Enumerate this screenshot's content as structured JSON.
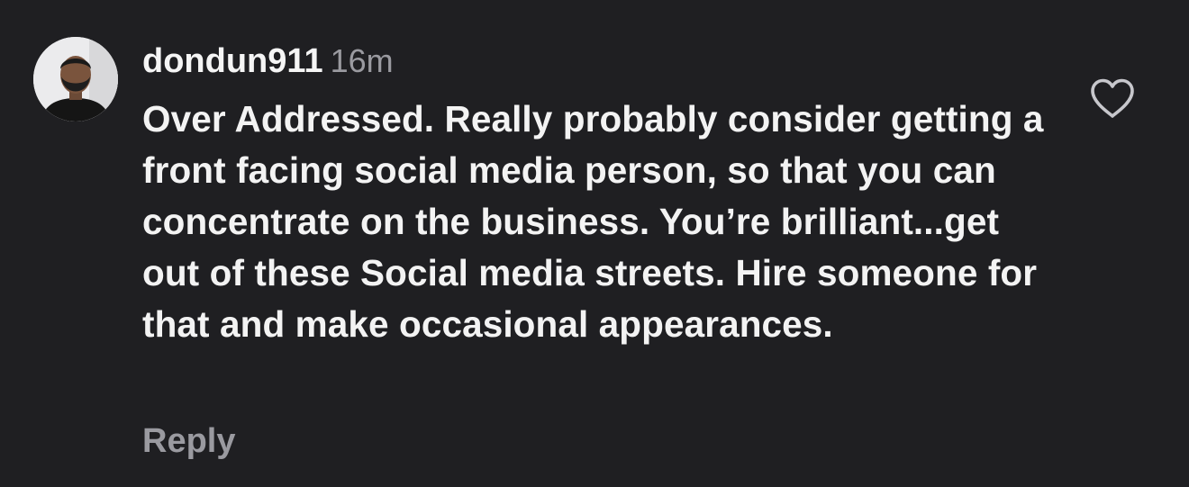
{
  "comment": {
    "username": "dondun911",
    "timestamp": "16m",
    "text": "Over Addressed. Really probably consider getting a front facing social media person, so that you can concentrate on the business. You’re brilliant...get out of these Social media streets. Hire someone for that and make occasional appearances.",
    "reply_label": "Reply",
    "like_icon": "heart-outline-icon",
    "avatar_icon": "profile-photo"
  },
  "colors": {
    "background": "#1f1f22",
    "primary_text": "#f5f5f5",
    "secondary_text": "#9a9aa0",
    "icon": "#c7c7cc"
  }
}
